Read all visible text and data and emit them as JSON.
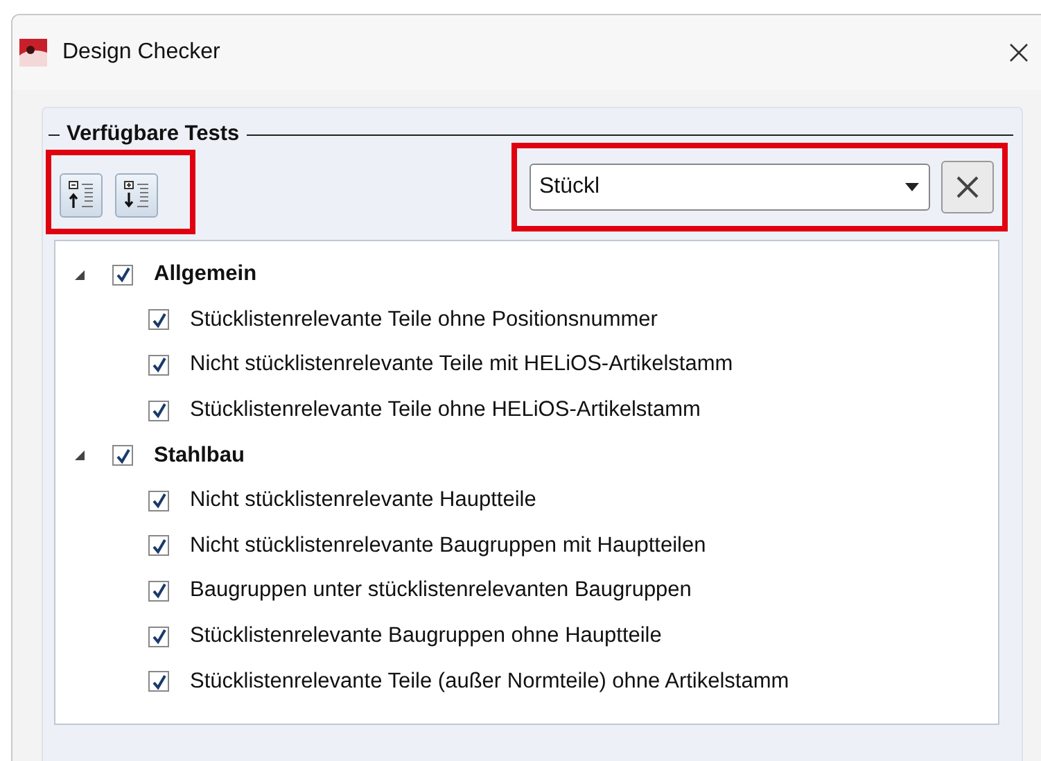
{
  "window": {
    "title": "Design Checker"
  },
  "panel": {
    "legend": "Verfügbare Tests"
  },
  "search": {
    "value": "Stückl"
  },
  "tree": [
    {
      "label": "Allgemein",
      "expanded": true,
      "checked": true,
      "children": [
        {
          "label": "Stücklistenrelevante Teile ohne Positionsnummer",
          "checked": true
        },
        {
          "label": "Nicht stücklistenrelevante Teile mit HELiOS-Artikelstamm",
          "checked": true
        },
        {
          "label": "Stücklistenrelevante Teile ohne HELiOS-Artikelstamm",
          "checked": true
        }
      ]
    },
    {
      "label": "Stahlbau",
      "expanded": true,
      "checked": true,
      "children": [
        {
          "label": "Nicht stücklistenrelevante Hauptteile",
          "checked": true
        },
        {
          "label": "Nicht stücklistenrelevante Baugruppen mit Hauptteilen",
          "checked": true
        },
        {
          "label": "Baugruppen unter stücklistenrelevanten Baugruppen",
          "checked": true
        },
        {
          "label": "Stücklistenrelevante Baugruppen ohne Hauptteile",
          "checked": true
        },
        {
          "label": "Stücklistenrelevante Teile (außer Normteile) ohne Artikelstamm",
          "checked": true
        }
      ]
    }
  ]
}
